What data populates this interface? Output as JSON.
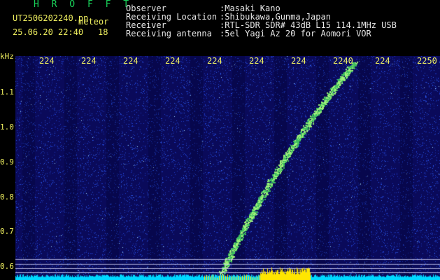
{
  "header": {
    "title": "H R O F F T",
    "filename": "UT2506202240.pn",
    "meteor_label": "meteor",
    "datetime": "25.06.20 22:40",
    "meteor_count": "18"
  },
  "info": {
    "labels": [
      "Observer",
      "Receiving Location",
      "Receiver",
      "Receiving antenna"
    ],
    "values": [
      ":Masaki Kano",
      ":Shibukawa,Gunma,Japan",
      ":RTL-SDR SDR# 43dB L15 114.1MHz USB",
      ":5el Yagi Az 20 for Aomori VOR"
    ]
  },
  "axes": {
    "y_unit": "kHz",
    "y_ticks": [
      "1.1",
      "1.0",
      "0.9",
      "0.8",
      "0.7",
      "0.6"
    ],
    "x_ticks": [
      "224",
      "224",
      "224",
      "224",
      "224",
      "224",
      "224",
      "2240",
      "224",
      "2250"
    ]
  },
  "colors": {
    "background": "#0a0a5a",
    "noise_blue": "#1e3cc8",
    "trace": "#9ef07a",
    "baseline": "#00d8ff",
    "burst": "#ffe600",
    "axis_text": "#f0f060"
  }
}
